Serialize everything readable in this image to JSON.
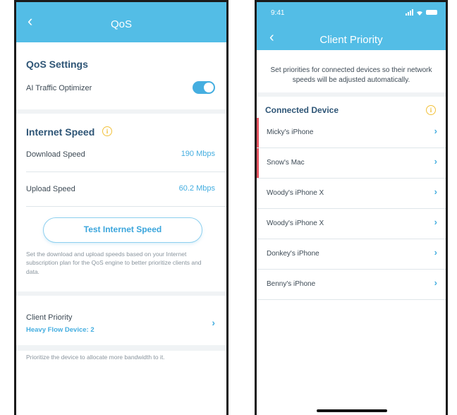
{
  "left_screen": {
    "header": {
      "back_icon": "chevron-left-icon",
      "title": "QoS"
    },
    "qos_settings": {
      "title": "QoS Settings",
      "ai_traffic_optimizer_label": "AI Traffic Optimizer",
      "ai_traffic_optimizer_on": true
    },
    "internet_speed": {
      "title": "Internet Speed",
      "info_icon": "info-icon",
      "download_label": "Download Speed",
      "download_value": "190 Mbps",
      "upload_label": "Upload Speed",
      "upload_value": "60.2 Mbps"
    },
    "test_button_label": "Test Internet Speed",
    "speed_note": "Set the download and upload speeds based on your Internet subscription plan for the QoS engine to better prioritize clients and data.",
    "client_priority": {
      "label": "Client Priority",
      "sub_label": "Heavy Flow Device: 2"
    },
    "priority_note": "Prioritize the device to allocate more bandwidth to it."
  },
  "right_screen": {
    "status_time": "9:41",
    "header": {
      "back_icon": "chevron-left-icon",
      "title": "Client Priority"
    },
    "intro_text": "Set priorities for connected devices so their network speeds will be adjusted automatically.",
    "connected_device_title": "Connected Device",
    "devices": [
      {
        "name": "Micky's iPhone",
        "prioritized": true
      },
      {
        "name": "Snow's Mac",
        "prioritized": true
      },
      {
        "name": "Woody's iPhone X",
        "prioritized": false
      },
      {
        "name": "Woody's iPhone X",
        "prioritized": false
      },
      {
        "name": "Donkey's iPhone",
        "prioritized": false
      },
      {
        "name": "Benny's iPhone",
        "prioritized": false
      }
    ]
  },
  "colors": {
    "header_blue": "#53bde6",
    "accent_blue": "#45aee0",
    "title_navy": "#2e5576",
    "info_yellow": "#f2c13a",
    "priority_red": "#e75561"
  }
}
